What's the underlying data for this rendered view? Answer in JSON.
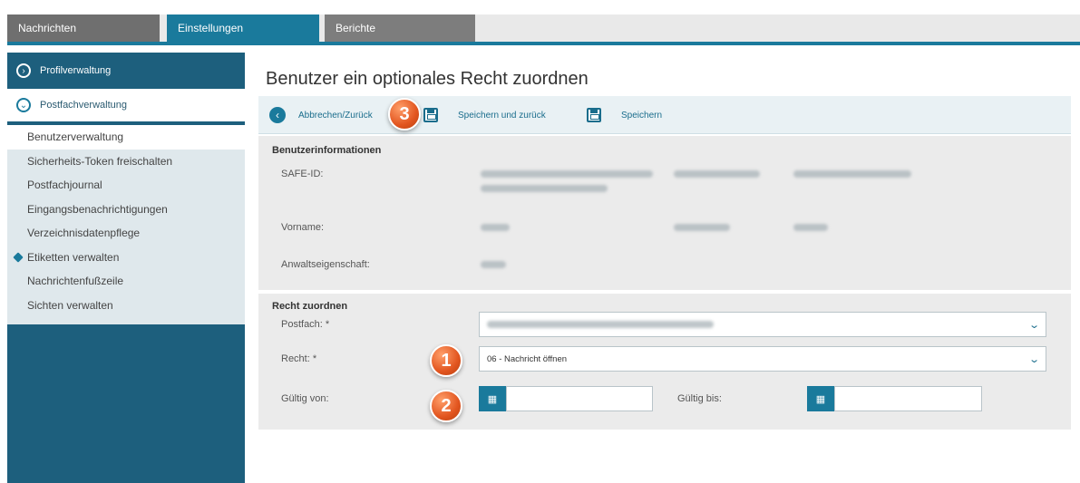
{
  "tabs": {
    "nachrichten": "Nachrichten",
    "einstellungen": "Einstellungen",
    "berichte": "Berichte"
  },
  "sidebar": {
    "profil": "Profilverwaltung",
    "postfach": "Postfachverwaltung",
    "items": [
      "Benutzerverwaltung",
      "Sicherheits-Token freischalten",
      "Postfachjournal",
      "Eingangsbenachrichtigungen",
      "Verzeichnisdatenpflege",
      "Etiketten verwalten",
      "Nachrichtenfußzeile",
      "Sichten verwalten"
    ]
  },
  "page": {
    "title": "Benutzer ein optionales Recht zuordnen"
  },
  "toolbar": {
    "back": "Abbrechen/Zurück",
    "save_back": "Speichern und zurück",
    "save": "Speichern"
  },
  "info": {
    "section": "Benutzerinformationen",
    "safe_id": "SAFE-ID:",
    "vorname": "Vorname:",
    "anwalt": "Anwaltseigenschaft:"
  },
  "recht": {
    "section": "Recht zuordnen",
    "postfach_label": "Postfach: *",
    "recht_label": "Recht: *",
    "recht_value": "06 - Nachricht öffnen",
    "von_label": "Gültig von:",
    "bis_label": "Gültig bis:"
  },
  "badges": [
    "1",
    "2",
    "3"
  ],
  "colors": {
    "accent": "#1a7a9c",
    "sidebar": "#1d5f7d",
    "badge": "#e2551f"
  }
}
